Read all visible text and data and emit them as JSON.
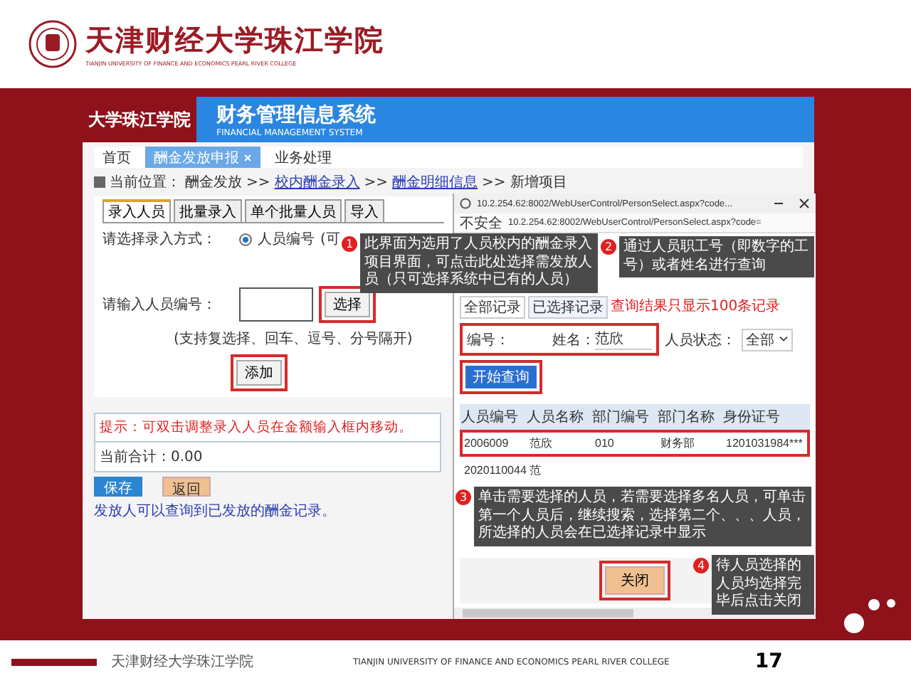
{
  "slide": {
    "school_name": "天津财经大学珠江学院",
    "school_name_en": "TIANJIN UNIVERSITY OF FINANCE AND ECONOMICS PEARL RIVER COLLEGE",
    "footer_name": "天津财经大学珠江学院",
    "footer_en": "TIANJIN UNIVERSITY OF FINANCE AND ECONOMICS PEARL RIVER COLLEGE",
    "page_number": "17"
  },
  "app": {
    "logo_text": "大学珠江学院",
    "title": "财务管理信息系统",
    "subtitle": "FINANCIAL MANAGEMENT SYSTEM",
    "tabs": [
      {
        "label": "首页",
        "selected": false,
        "closable": false
      },
      {
        "label": "酬金发放申报",
        "selected": true,
        "closable": true
      },
      {
        "label": "业务处理",
        "selected": false,
        "closable": false
      }
    ],
    "breadcrumb": {
      "label": "当前位置：",
      "separator": ">>",
      "items": [
        {
          "text": "酬金发放",
          "link": false
        },
        {
          "text": "校内酬金录入",
          "link": true
        },
        {
          "text": "酬金明细信息",
          "link": true
        },
        {
          "text": "新增项目",
          "link": false
        }
      ]
    },
    "form_tabs": [
      {
        "label": "录入人员",
        "selected": true
      },
      {
        "label": "批量录入",
        "selected": false
      },
      {
        "label": "单个批量人员",
        "selected": false
      },
      {
        "label": "导入",
        "selected": false
      }
    ],
    "entry_mode_label": "请选择录入方式：",
    "entry_mode_option": "人员编号",
    "entry_mode_selected": true,
    "entry_mode_option_2": "(可",
    "person_id_label": "请输入人员编号：",
    "select_button": "选择",
    "hint": "(支持复选择、回车、逗号、分号隔开)",
    "add_button": "添加",
    "notice": "提示：可双击调整录入人员在金额输入框内移动。",
    "total": "当前合计：0.00",
    "save_button": "保存",
    "back_button": "返回",
    "footer_link": "发放人可以查询到已发放的酬金记录。"
  },
  "popup": {
    "url": "10.2.254.62:8002/WebUserControl/PersonSelect.aspx?code...",
    "security": "不安全",
    "address": "10.2.254.62:8002/WebUserControl/PersonSelect.aspx?code=",
    "links": [
      {
        "label": "全部记录",
        "selected": false
      },
      {
        "label": "已选择记录",
        "selected": true
      }
    ],
    "limit_note": "查询结果只显示100条记录",
    "id_label": "编号：",
    "name_label": "姓名：",
    "name_value": "范欣",
    "status_label": "人员状态：",
    "status_value": "全部",
    "search_button": "开始查询",
    "columns": [
      "人员编号",
      "人员名称",
      "部门编号",
      "部门名称",
      "身份证号"
    ],
    "rows": [
      {
        "cells": [
          "2006009",
          "范欣",
          "010",
          "财务部",
          "1201031984***"
        ],
        "highlighted": true
      },
      {
        "cells": [
          "2020110044",
          "范"
        ],
        "highlighted": false
      }
    ],
    "close_button": "关闭"
  },
  "callouts": [
    {
      "number": "1",
      "text": "此界面为选用了人员校内的酬金录入项目界面，可点击此处选择需发放人员（只可选择系统中已有的人员）"
    },
    {
      "number": "2",
      "text": "通过人员职工号（即数字的工号）或者姓名进行查询"
    },
    {
      "number": "3",
      "text": "单击需要选择的人员，若需要选择多名人员，可单击第一个人员后，继续搜索，选择第二个、、、人员，所选择的人员会在已选择记录中显示"
    },
    {
      "number": "4",
      "text": "待人员选择的人员均选择完毕后点击关闭"
    }
  ]
}
